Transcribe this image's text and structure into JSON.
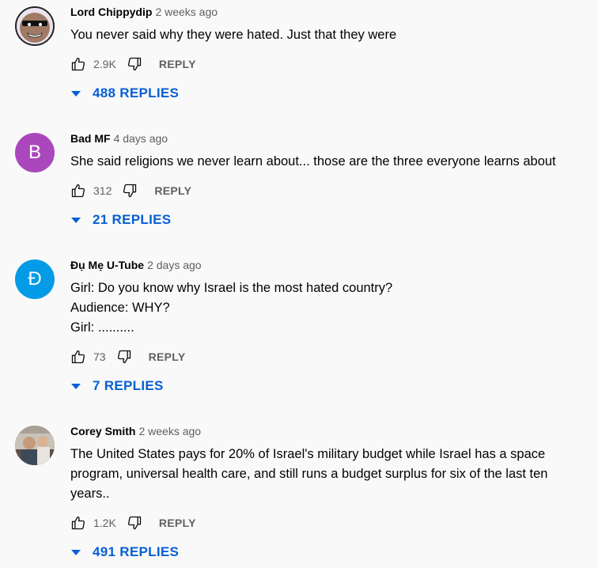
{
  "comments": [
    {
      "author": "Lord Chippydip",
      "time": "2 weeks ago",
      "text": "You never said why they were hated. Just that they were",
      "likes": "2.9K",
      "reply_label": "REPLY",
      "replies_label": "488 REPLIES",
      "avatar_letter": "",
      "avatar_color": "#9c7b6a"
    },
    {
      "author": "Bad MF",
      "time": "4 days ago",
      "text": "She said religions we never learn about... those are the three everyone learns about",
      "likes": "312",
      "reply_label": "REPLY",
      "replies_label": "21 REPLIES",
      "avatar_letter": "B",
      "avatar_color": "#ab47bc"
    },
    {
      "author": "Đụ Mẹ U-Tube",
      "time": "2 days ago",
      "text": "Girl:  Do you know why Israel is the most hated country?\nAudience:  WHY?\nGirl: ..........",
      "likes": "73",
      "reply_label": "REPLY",
      "replies_label": "7 REPLIES",
      "avatar_letter": "Đ",
      "avatar_color": "#039be5"
    },
    {
      "author": "Corey Smith",
      "time": "2 weeks ago",
      "text": "The United States pays for 20% of Israel's military budget while Israel has a space program, universal health care, and still runs a budget surplus for six of the last ten years..",
      "likes": "1.2K",
      "reply_label": "REPLY",
      "replies_label": "491 REPLIES",
      "avatar_letter": "",
      "avatar_color": "#7a6f66"
    }
  ]
}
